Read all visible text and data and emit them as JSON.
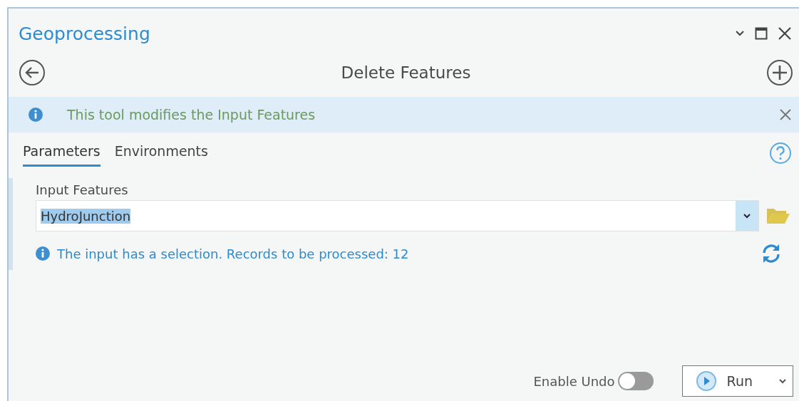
{
  "pane": {
    "title": "Geoprocessing"
  },
  "tool": {
    "title": "Delete Features"
  },
  "banner": {
    "message": "This tool modifies the Input Features"
  },
  "tabs": [
    {
      "label": "Parameters",
      "selected": true
    },
    {
      "label": "Environments",
      "selected": false
    }
  ],
  "parameter": {
    "label": "Input Features",
    "value": "HydroJunction",
    "value_selected": true,
    "message": "The input has a selection. Records to be processed: 12"
  },
  "undo": {
    "label": "Enable Undo",
    "on": false
  },
  "run_button": {
    "label": "Run"
  }
}
